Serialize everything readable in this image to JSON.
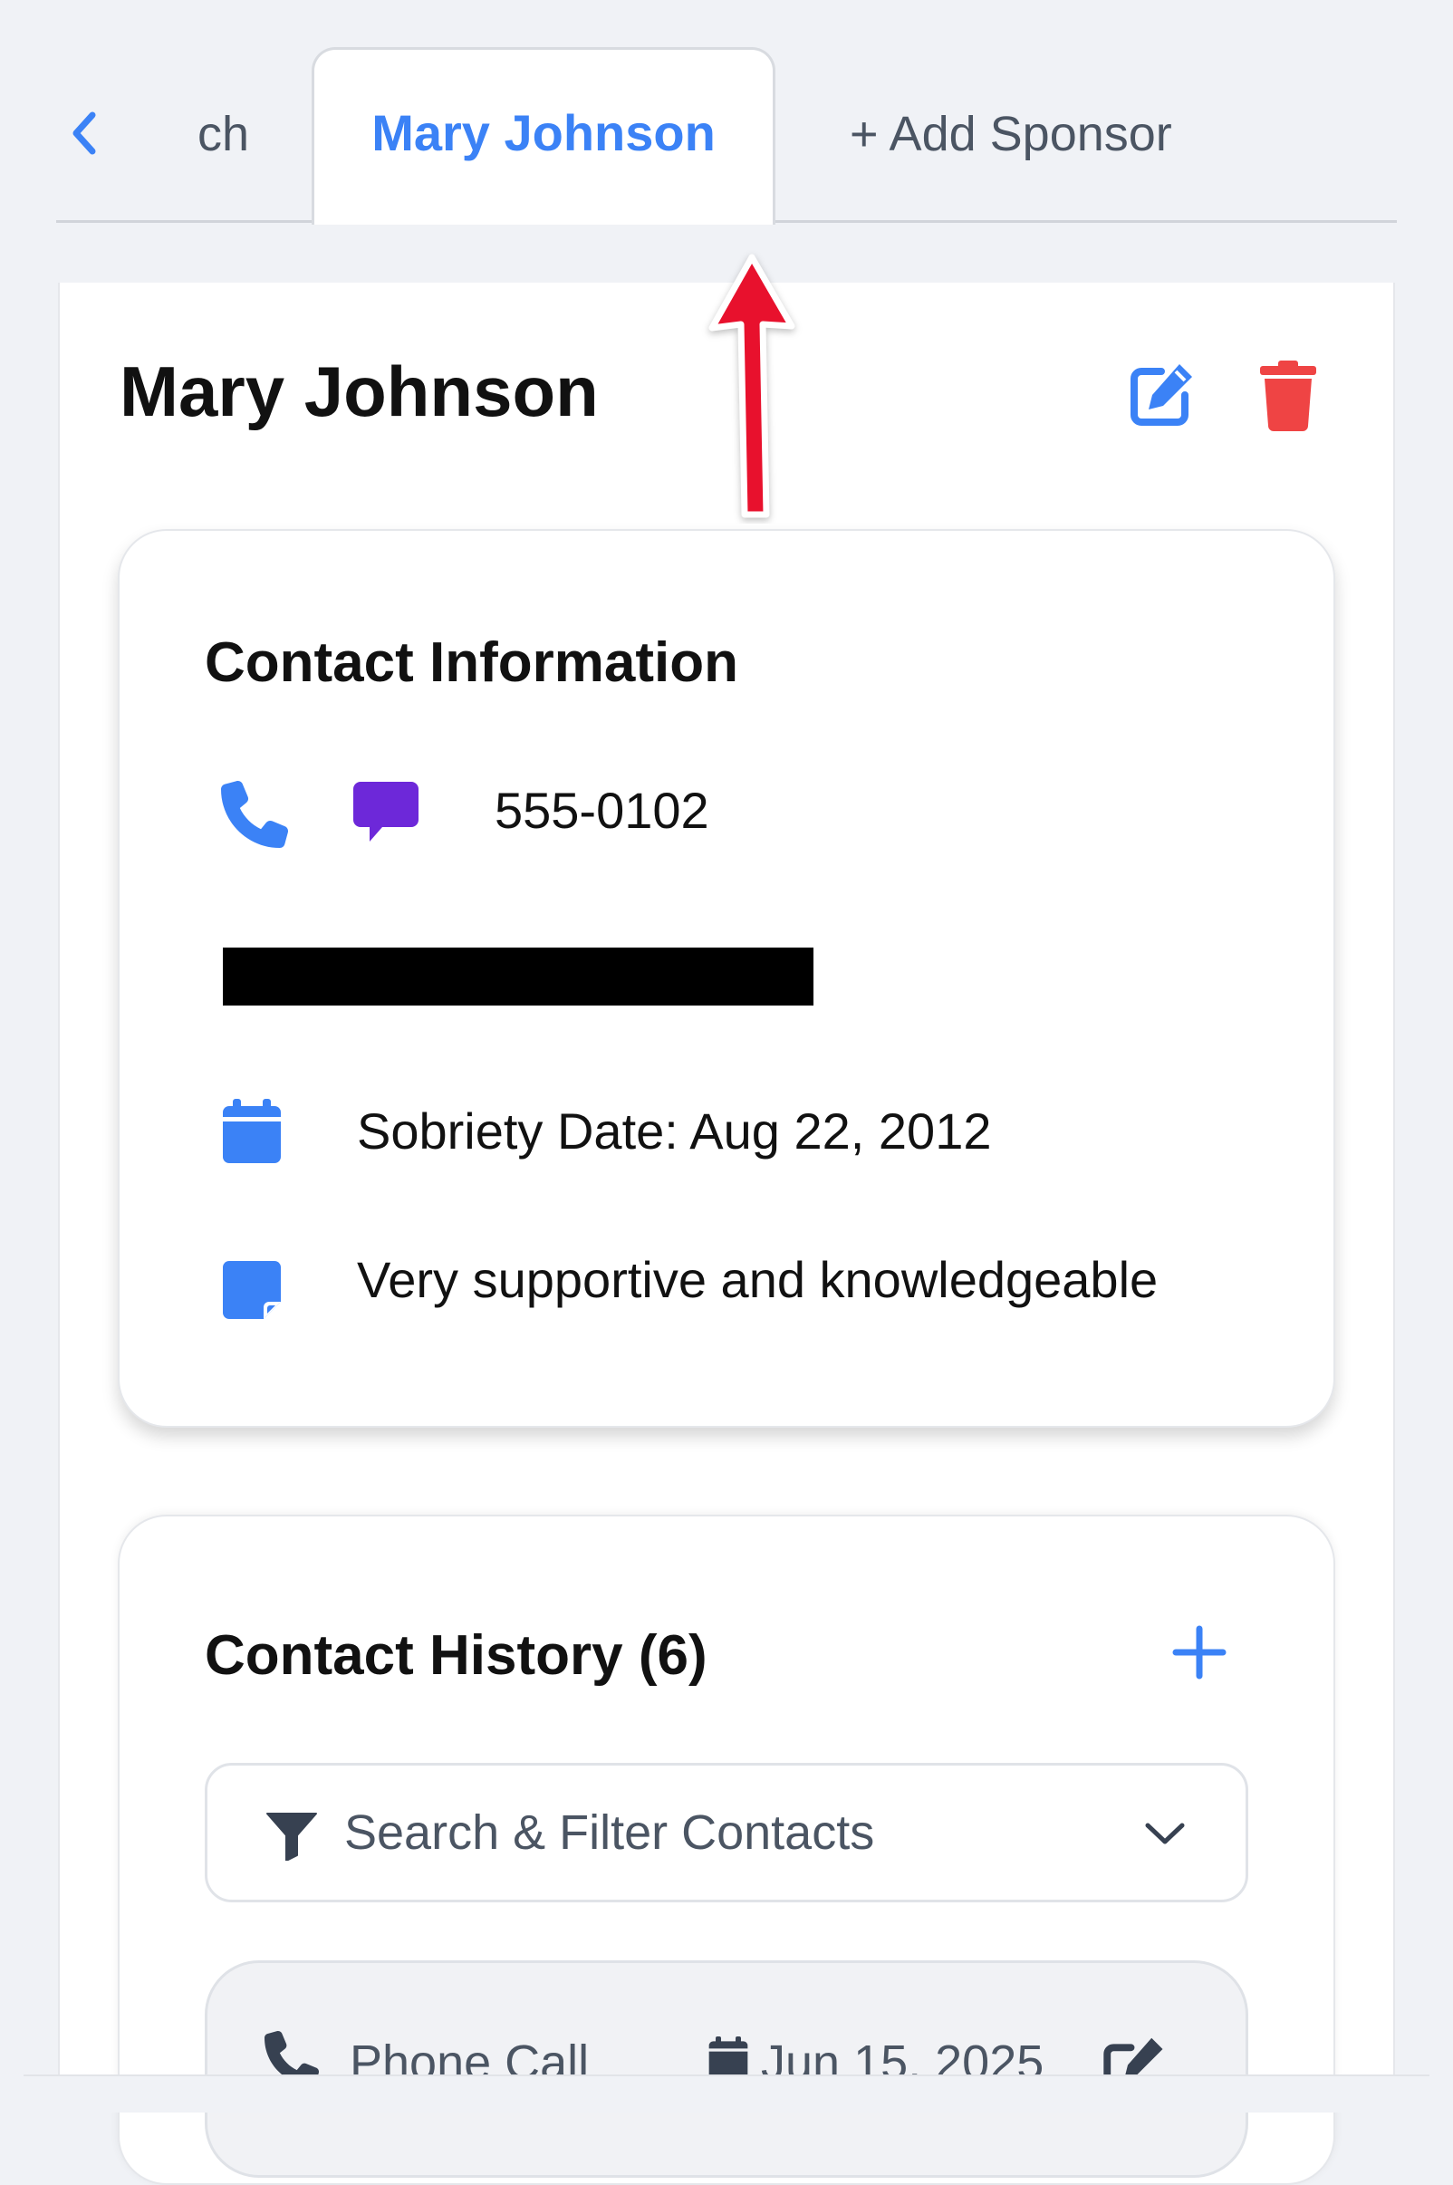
{
  "tabs": {
    "partial_label": "ch",
    "active_label": "Mary Johnson",
    "add_label": "+ Add Sponsor"
  },
  "profile": {
    "name": "Mary Johnson"
  },
  "contact_info": {
    "heading": "Contact Information",
    "phone": "555-0102",
    "sobriety": "Sobriety Date: Aug 22, 2012",
    "note": "Very supportive and knowledgeable"
  },
  "history": {
    "heading": "Contact History (6)",
    "filter_label": "Search & Filter Contacts",
    "entries": [
      {
        "type": "Phone Call",
        "date": "Jun 15, 2025"
      }
    ]
  },
  "colors": {
    "accent": "#3b82f6",
    "danger": "#ef4444",
    "message": "#6d28d9",
    "annotation": "#e8112d"
  },
  "icons": {
    "back": "chevron-left-icon",
    "edit": "edit-icon",
    "delete": "trash-icon",
    "phone": "phone-icon",
    "message": "message-icon",
    "calendar": "calendar-icon",
    "note": "note-icon",
    "add": "plus-icon",
    "filter": "filter-icon",
    "expand": "chevron-down-icon"
  }
}
